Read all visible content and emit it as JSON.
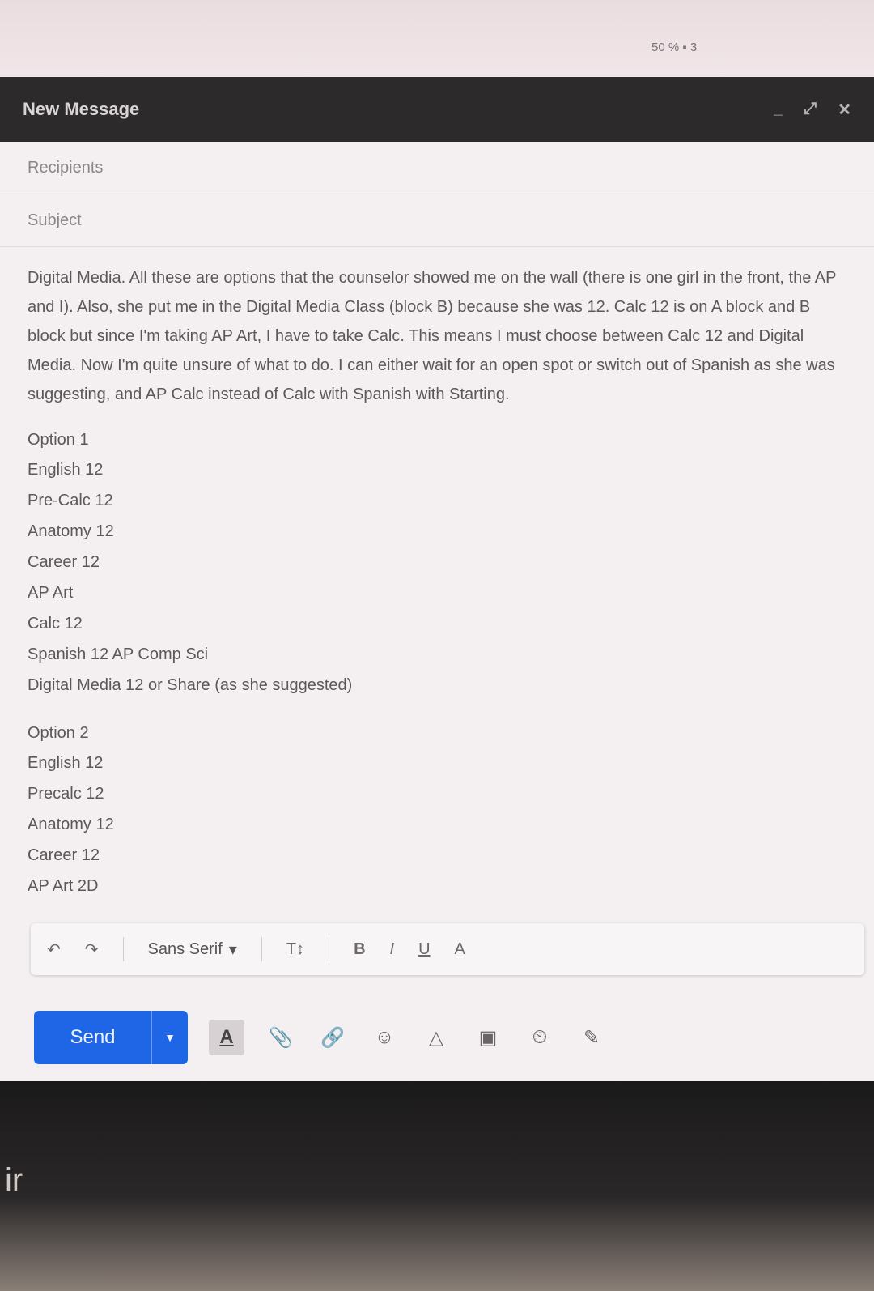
{
  "top_text": "50 % ▪ 3",
  "compose": {
    "title": "New Message",
    "header_actions": [
      "_",
      "⤢",
      "✕"
    ],
    "recipients_placeholder": "Recipients",
    "subject_placeholder": "Subject",
    "body_paragraph": "Digital Media. All these are options that the counselor showed me on the wall (there is one girl in the front, the AP and I). Also, she put me in the Digital Media Class (block B) because she was 12. Calc 12 is on A block and B block but since I'm taking AP Art, I have to take Calc. This means I must choose between Calc 12 and Digital Media. Now I'm quite unsure of what to do. I can either wait for an open spot or switch out of Spanish as she was suggesting, and AP Calc instead of Calc with Spanish with Starting.",
    "option1": {
      "heading": "Option 1",
      "courses": [
        "English 12",
        "Pre-Calc 12",
        "Anatomy 12",
        "Career 12",
        "AP Art",
        "Calc 12",
        "Spanish 12 AP Comp Sci",
        "Digital Media 12 or Share (as she suggested)"
      ]
    },
    "option2": {
      "heading": "Option 2",
      "courses": [
        "English 12",
        "Precalc 12",
        "Anatomy 12",
        "Career 12",
        "AP Art 2D"
      ]
    },
    "toolbar": {
      "undo_icon": "↶",
      "redo_icon": "↷",
      "font_label": "Sans Serif",
      "font_caret": "▾",
      "size_icon": "T↕",
      "bold_icon": "B",
      "italic_icon": "I",
      "underline_icon": "U",
      "text_color_icon": "A"
    },
    "send_label": "Send",
    "send_more_icon": "▼",
    "bottom_icons": {
      "format": "A",
      "attach": "📎",
      "link": "🔗",
      "emoji": "☺",
      "drive": "△",
      "photo": "▣",
      "confidential": "⏲",
      "signature": "✎"
    }
  },
  "desk_text": "ir"
}
